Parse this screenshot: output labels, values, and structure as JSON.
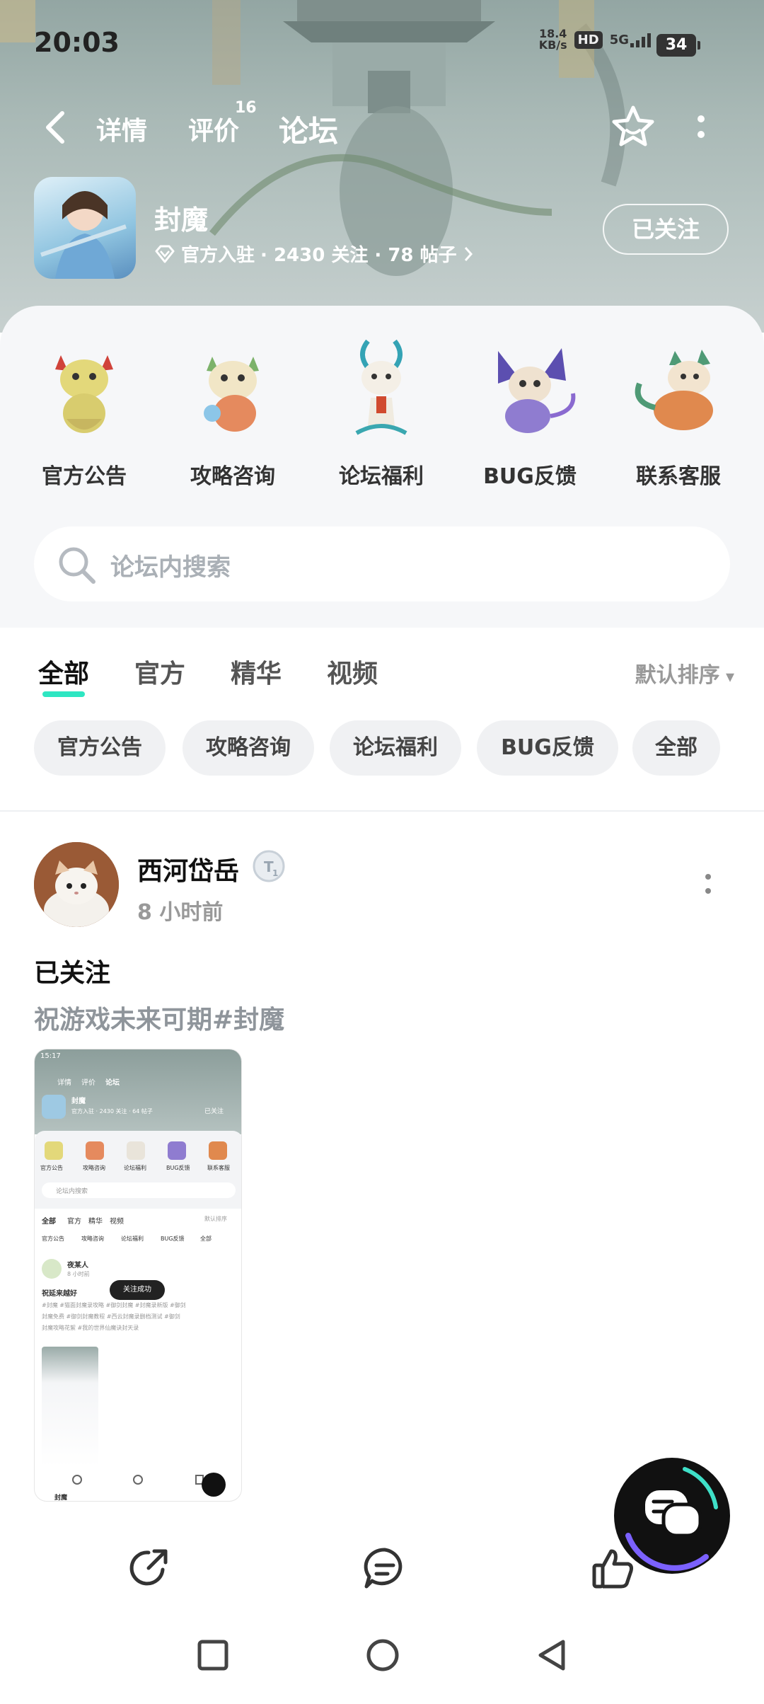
{
  "status_bar": {
    "time": "20:03",
    "net_speed_value": "18.4",
    "net_speed_unit": "KB/s",
    "hd": "HD",
    "network": "5G",
    "battery": "34"
  },
  "nav": {
    "tab_detail": "详情",
    "tab_review": "评价",
    "review_count": "16",
    "tab_forum": "论坛",
    "accent_color": "#2ee6c2"
  },
  "game": {
    "name": "封魔",
    "badge": "官方入驻",
    "stats": "· 2430 关注 · 78 帖子",
    "follow_label": "已关注"
  },
  "categories": [
    {
      "label": "官方公告",
      "icon": "dragon-mascot-yellow"
    },
    {
      "label": "攻略咨询",
      "icon": "dragon-mascot-green"
    },
    {
      "label": "论坛福利",
      "icon": "dragon-mascot-white"
    },
    {
      "label": "BUG反馈",
      "icon": "dragon-mascot-purple"
    },
    {
      "label": "联系客服",
      "icon": "dragon-mascot-orange"
    }
  ],
  "search": {
    "placeholder": "论坛内搜索"
  },
  "feed_tabs": [
    "全部",
    "官方",
    "精华",
    "视频"
  ],
  "sort_label": "默认排序",
  "chips": [
    "官方公告",
    "攻略咨询",
    "论坛福利",
    "BUG反馈",
    "全部"
  ],
  "post": {
    "author": "西河岱岳",
    "level": "T1",
    "time": "8 小时前",
    "title": "已关注",
    "body": "祝游戏未来可期#封魔",
    "image": {
      "time": "15:17",
      "tabs": [
        "详情",
        "评价",
        "论坛"
      ],
      "game": "封魔",
      "meta": "官方入驻 · 2430 关注 · 64 帖子",
      "follow": "已关注",
      "cats": [
        "官方公告",
        "攻略咨询",
        "论坛福利",
        "BUG反馈",
        "联系客服"
      ],
      "search": "论坛内搜索",
      "tabs2": [
        "全部",
        "官方",
        "精华",
        "视频"
      ],
      "sort": "默认排序",
      "chips": [
        "官方公告",
        "攻略咨询",
        "论坛福利",
        "BUG反馈",
        "全部"
      ],
      "author": "夜某人",
      "ptime": "8 小时前",
      "toast": "关注成功",
      "ptitle": "祝延来越好",
      "tags1": "#封魔 #猫面封魔录攻略 #御剑封魔 #封魔录新版 #御剑",
      "tags2": "封魔免费 #御剑封魔教程 #西云封魔录删档测试 #御剑",
      "tags3": "封魔攻略花絮 #我的世界仙魔诀封天录",
      "footer": "封魔"
    }
  },
  "actions": [
    "share-icon",
    "comment-icon",
    "like-icon"
  ],
  "system_nav": [
    "recents",
    "home",
    "back"
  ]
}
